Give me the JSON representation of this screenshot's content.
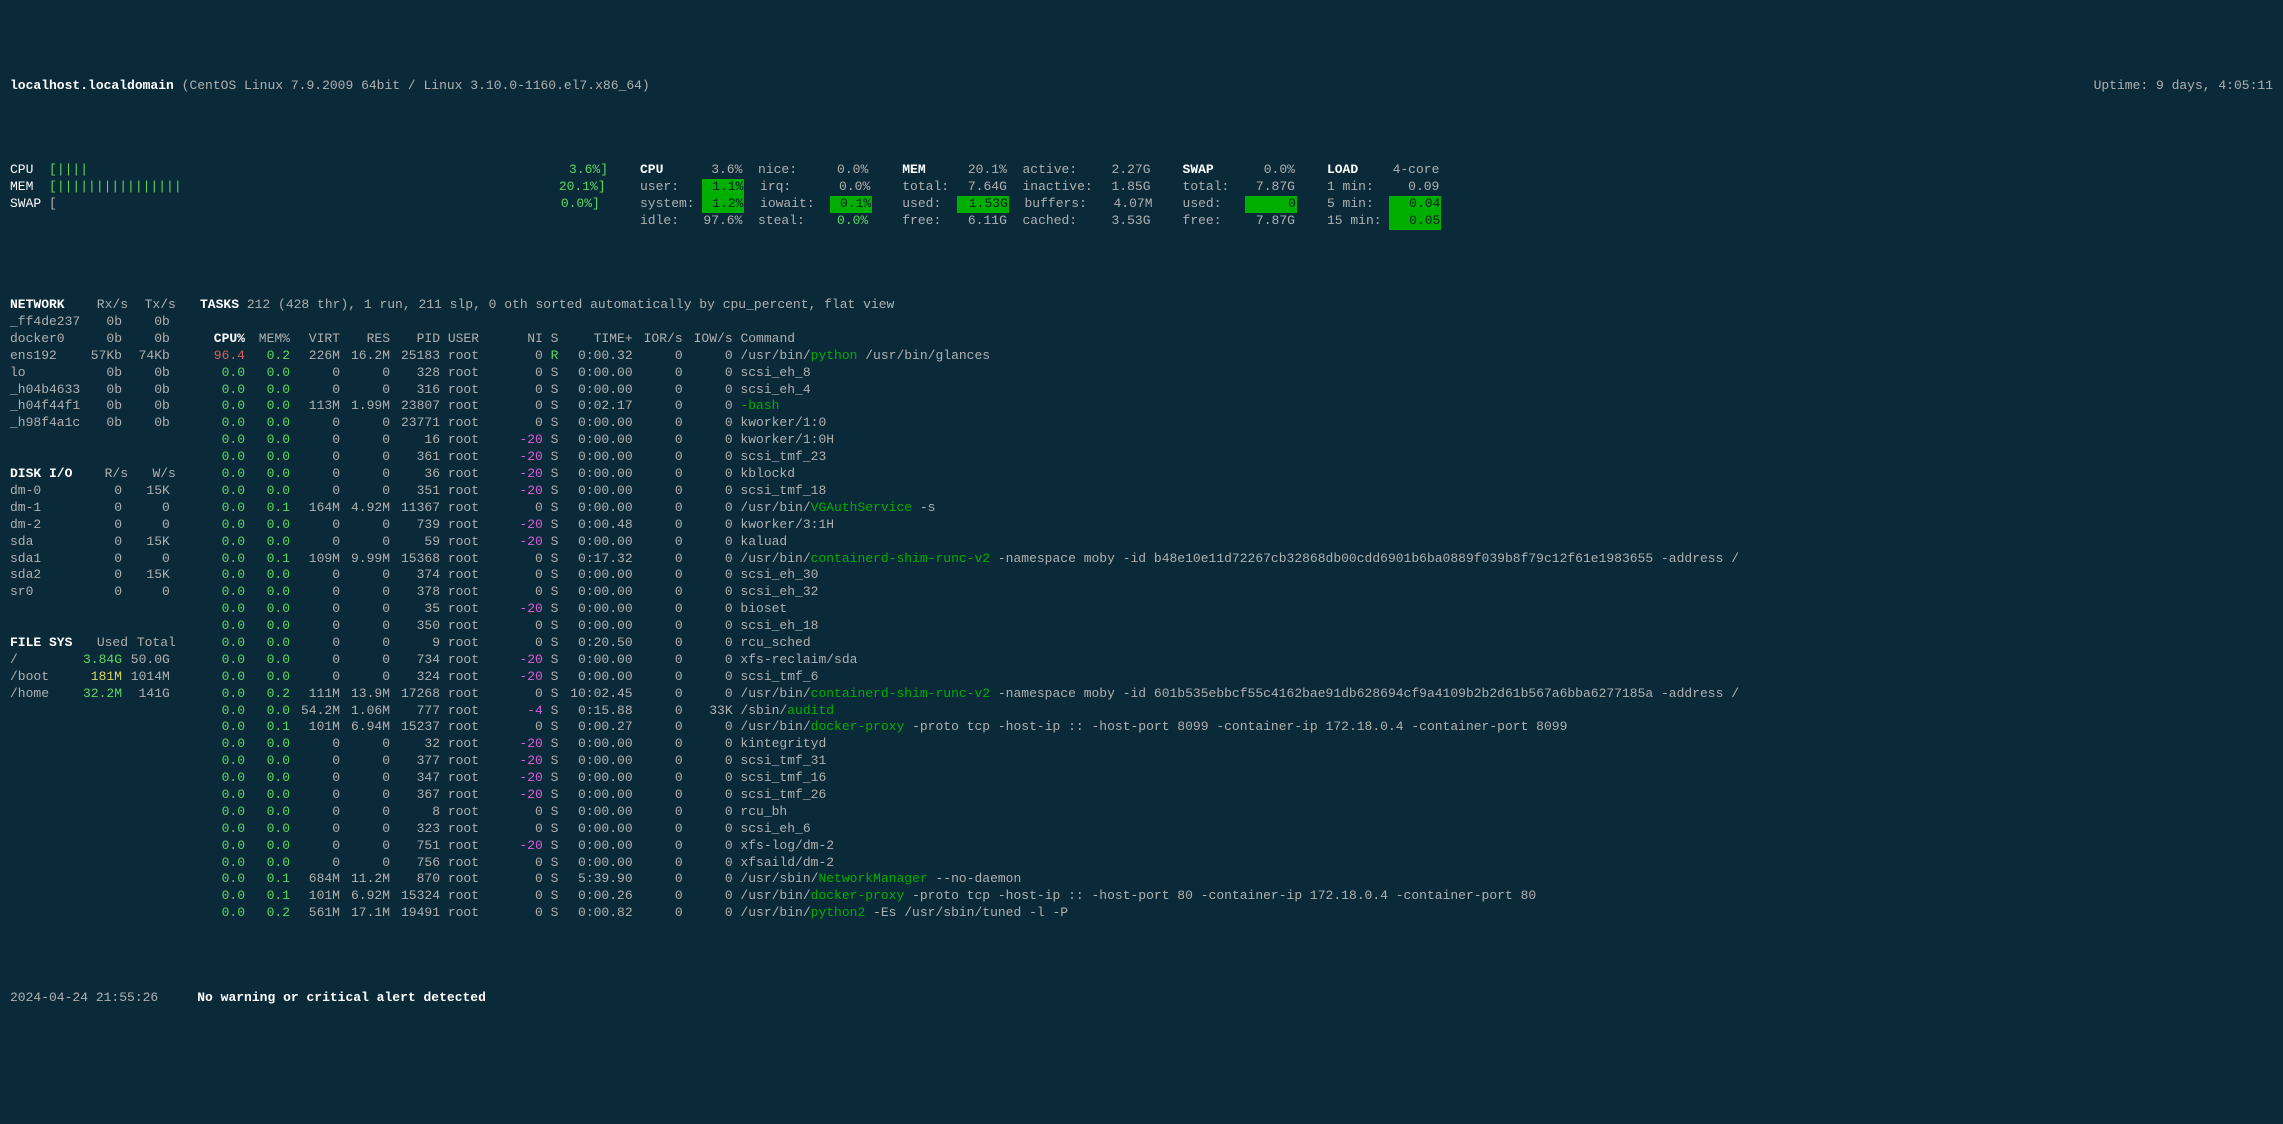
{
  "header": {
    "hostname": "localhost.localdomain",
    "os": "(CentOS Linux 7.9.2009 64bit / Linux 3.10.0-1160.el7.x86_64)",
    "uptime": "Uptime: 9 days, 4:05:11"
  },
  "bars": {
    "cpu_label": "CPU",
    "cpu_bar": "[||||",
    "cpu_pct": "3.6%]",
    "mem_label": "MEM",
    "mem_bar": "[||||||||||||||||",
    "mem_pct": "20.1%]",
    "swap_label": "SWAP",
    "swap_bar": "[",
    "swap_pct": "0.0%]"
  },
  "cpu_detail": {
    "cpu": "CPU",
    "cpu_v": "3.6%",
    "user": "user:",
    "user_v": "1.1%",
    "system": "system:",
    "system_v": "1.2%",
    "idle": "idle:",
    "idle_v": "97.6%",
    "nice": "nice:",
    "nice_v": "0.0%",
    "irq": "irq:",
    "irq_v": "0.0%",
    "iowait": "iowait:",
    "iowait_v": "0.1%",
    "steal": "steal:",
    "steal_v": "0.0%"
  },
  "mem_detail": {
    "mem": "MEM",
    "mem_v": "20.1%",
    "total": "total:",
    "total_v": "7.64G",
    "used": "used:",
    "used_v": "1.53G",
    "free": "free:",
    "free_v": "6.11G",
    "active": "active:",
    "active_v": "2.27G",
    "inactive": "inactive:",
    "inactive_v": "1.85G",
    "buffers": "buffers:",
    "buffers_v": "4.07M",
    "cached": "cached:",
    "cached_v": "3.53G"
  },
  "swap_detail": {
    "swap": "SWAP",
    "swap_v": "0.0%",
    "total": "total:",
    "total_v": "7.87G",
    "used": "used:",
    "used_v": "0",
    "free": "free:",
    "free_v": "7.87G"
  },
  "load_detail": {
    "load": "LOAD",
    "cores": "4-core",
    "l1": "1 min:",
    "l1v": "0.09",
    "l5": "5 min:",
    "l5v": "0.04",
    "l15": "15 min:",
    "l15v": "0.05"
  },
  "network": {
    "title": "NETWORK",
    "rx": "Rx/s",
    "tx": "Tx/s",
    "rows": [
      {
        "n": "_ff4de237",
        "rx": "0b",
        "tx": "0b"
      },
      {
        "n": "docker0",
        "rx": "0b",
        "tx": "0b"
      },
      {
        "n": "ens192",
        "rx": "57Kb",
        "tx": "74Kb"
      },
      {
        "n": "lo",
        "rx": "0b",
        "tx": "0b"
      },
      {
        "n": "_h04b4633",
        "rx": "0b",
        "tx": "0b"
      },
      {
        "n": "_h04f44f1",
        "rx": "0b",
        "tx": "0b"
      },
      {
        "n": "_h98f4a1c",
        "rx": "0b",
        "tx": "0b"
      }
    ]
  },
  "diskio": {
    "title": "DISK I/O",
    "r": "R/s",
    "w": "W/s",
    "rows": [
      {
        "n": "dm-0",
        "r": "0",
        "w": "15K"
      },
      {
        "n": "dm-1",
        "r": "0",
        "w": "0"
      },
      {
        "n": "dm-2",
        "r": "0",
        "w": "0"
      },
      {
        "n": "sda",
        "r": "0",
        "w": "15K"
      },
      {
        "n": "sda1",
        "r": "0",
        "w": "0"
      },
      {
        "n": "sda2",
        "r": "0",
        "w": "15K"
      },
      {
        "n": "sr0",
        "r": "0",
        "w": "0"
      }
    ]
  },
  "fs": {
    "title": "FILE SYS",
    "used": "Used",
    "total": "Total",
    "rows": [
      {
        "n": "/",
        "u": "3.84G",
        "t": "50.0G",
        "c": "green"
      },
      {
        "n": "/boot",
        "u": "181M",
        "t": "1014M",
        "c": "yellow"
      },
      {
        "n": "/home",
        "u": "32.2M",
        "t": "141G",
        "c": "green"
      }
    ]
  },
  "tasks_hdr": {
    "title": "TASKS",
    "summary": "212 (428 thr), 1 run, 211 slp, 0 oth sorted automatically by cpu_percent, flat view"
  },
  "proc_hdr": [
    "CPU%",
    "MEM%",
    "VIRT",
    "RES",
    "PID",
    "USER",
    "NI",
    "S",
    "TIME+",
    "IOR/s",
    "IOW/s",
    "Command"
  ],
  "procs": [
    {
      "cpu": "96.4",
      "cpuc": "red",
      "mem": "0.2",
      "virt": "226M",
      "res": "16.2M",
      "pid": "25183",
      "user": "root",
      "ni": "0",
      "s": "R",
      "sc": "green",
      "time": "0:00.32",
      "ior": "0",
      "iow": "0",
      "cmd": "/usr/bin/",
      "hl": "python",
      "rest": " /usr/bin/glances"
    },
    {
      "cpu": "0.0",
      "cpuc": "green",
      "mem": "0.0",
      "virt": "0",
      "res": "0",
      "pid": "328",
      "user": "root",
      "ni": "0",
      "s": "S",
      "time": "0:00.00",
      "ior": "0",
      "iow": "0",
      "cmd": "scsi_eh_8"
    },
    {
      "cpu": "0.0",
      "cpuc": "green",
      "mem": "0.0",
      "virt": "0",
      "res": "0",
      "pid": "316",
      "user": "root",
      "ni": "0",
      "s": "S",
      "time": "0:00.00",
      "ior": "0",
      "iow": "0",
      "cmd": "scsi_eh_4"
    },
    {
      "cpu": "0.0",
      "cpuc": "green",
      "mem": "0.0",
      "virt": "113M",
      "res": "1.99M",
      "pid": "23807",
      "user": "root",
      "ni": "0",
      "s": "S",
      "time": "0:02.17",
      "ior": "0",
      "iow": "0",
      "cmd": "",
      "hl": "-bash",
      "rest": ""
    },
    {
      "cpu": "0.0",
      "cpuc": "green",
      "mem": "0.0",
      "virt": "0",
      "res": "0",
      "pid": "23771",
      "user": "root",
      "ni": "0",
      "s": "S",
      "time": "0:00.00",
      "ior": "0",
      "iow": "0",
      "cmd": "kworker/1:0"
    },
    {
      "cpu": "0.0",
      "cpuc": "green",
      "mem": "0.0",
      "virt": "0",
      "res": "0",
      "pid": "16",
      "user": "root",
      "ni": "-20",
      "nic": "magenta",
      "s": "S",
      "time": "0:00.00",
      "ior": "0",
      "iow": "0",
      "cmd": "kworker/1:0H"
    },
    {
      "cpu": "0.0",
      "cpuc": "green",
      "mem": "0.0",
      "virt": "0",
      "res": "0",
      "pid": "361",
      "user": "root",
      "ni": "-20",
      "nic": "magenta",
      "s": "S",
      "time": "0:00.00",
      "ior": "0",
      "iow": "0",
      "cmd": "scsi_tmf_23"
    },
    {
      "cpu": "0.0",
      "cpuc": "green",
      "mem": "0.0",
      "virt": "0",
      "res": "0",
      "pid": "36",
      "user": "root",
      "ni": "-20",
      "nic": "magenta",
      "s": "S",
      "time": "0:00.00",
      "ior": "0",
      "iow": "0",
      "cmd": "kblockd"
    },
    {
      "cpu": "0.0",
      "cpuc": "green",
      "mem": "0.0",
      "virt": "0",
      "res": "0",
      "pid": "351",
      "user": "root",
      "ni": "-20",
      "nic": "magenta",
      "s": "S",
      "time": "0:00.00",
      "ior": "0",
      "iow": "0",
      "cmd": "scsi_tmf_18"
    },
    {
      "cpu": "0.0",
      "cpuc": "green",
      "mem": "0.1",
      "virt": "164M",
      "res": "4.92M",
      "pid": "11367",
      "user": "root",
      "ni": "0",
      "s": "S",
      "time": "0:00.00",
      "ior": "0",
      "iow": "0",
      "cmd": "/usr/bin/",
      "hl": "VGAuthService",
      "rest": " -s"
    },
    {
      "cpu": "0.0",
      "cpuc": "green",
      "mem": "0.0",
      "virt": "0",
      "res": "0",
      "pid": "739",
      "user": "root",
      "ni": "-20",
      "nic": "magenta",
      "s": "S",
      "time": "0:00.48",
      "ior": "0",
      "iow": "0",
      "cmd": "kworker/3:1H"
    },
    {
      "cpu": "0.0",
      "cpuc": "green",
      "mem": "0.0",
      "virt": "0",
      "res": "0",
      "pid": "59",
      "user": "root",
      "ni": "-20",
      "nic": "magenta",
      "s": "S",
      "time": "0:00.00",
      "ior": "0",
      "iow": "0",
      "cmd": "kaluad"
    },
    {
      "cpu": "0.0",
      "cpuc": "green",
      "mem": "0.1",
      "virt": "109M",
      "res": "9.99M",
      "pid": "15368",
      "user": "root",
      "ni": "0",
      "s": "S",
      "time": "0:17.32",
      "ior": "0",
      "iow": "0",
      "cmd": "/usr/bin/",
      "hl": "containerd-shim-runc-v2",
      "rest": " -namespace moby -id b48e10e11d72267cb32868db00cdd6901b6ba0889f039b8f79c12f61e1983655 -address /"
    },
    {
      "cpu": "0.0",
      "cpuc": "green",
      "mem": "0.0",
      "virt": "0",
      "res": "0",
      "pid": "374",
      "user": "root",
      "ni": "0",
      "s": "S",
      "time": "0:00.00",
      "ior": "0",
      "iow": "0",
      "cmd": "scsi_eh_30"
    },
    {
      "cpu": "0.0",
      "cpuc": "green",
      "mem": "0.0",
      "virt": "0",
      "res": "0",
      "pid": "378",
      "user": "root",
      "ni": "0",
      "s": "S",
      "time": "0:00.00",
      "ior": "0",
      "iow": "0",
      "cmd": "scsi_eh_32"
    },
    {
      "cpu": "0.0",
      "cpuc": "green",
      "mem": "0.0",
      "virt": "0",
      "res": "0",
      "pid": "35",
      "user": "root",
      "ni": "-20",
      "nic": "magenta",
      "s": "S",
      "time": "0:00.00",
      "ior": "0",
      "iow": "0",
      "cmd": "bioset"
    },
    {
      "cpu": "0.0",
      "cpuc": "green",
      "mem": "0.0",
      "virt": "0",
      "res": "0",
      "pid": "350",
      "user": "root",
      "ni": "0",
      "s": "S",
      "time": "0:00.00",
      "ior": "0",
      "iow": "0",
      "cmd": "scsi_eh_18"
    },
    {
      "cpu": "0.0",
      "cpuc": "green",
      "mem": "0.0",
      "virt": "0",
      "res": "0",
      "pid": "9",
      "user": "root",
      "ni": "0",
      "s": "S",
      "time": "0:20.50",
      "ior": "0",
      "iow": "0",
      "cmd": "rcu_sched"
    },
    {
      "cpu": "0.0",
      "cpuc": "green",
      "mem": "0.0",
      "virt": "0",
      "res": "0",
      "pid": "734",
      "user": "root",
      "ni": "-20",
      "nic": "magenta",
      "s": "S",
      "time": "0:00.00",
      "ior": "0",
      "iow": "0",
      "cmd": "xfs-reclaim/sda"
    },
    {
      "cpu": "0.0",
      "cpuc": "green",
      "mem": "0.0",
      "virt": "0",
      "res": "0",
      "pid": "324",
      "user": "root",
      "ni": "-20",
      "nic": "magenta",
      "s": "S",
      "time": "0:00.00",
      "ior": "0",
      "iow": "0",
      "cmd": "scsi_tmf_6"
    },
    {
      "cpu": "0.0",
      "cpuc": "green",
      "mem": "0.2",
      "virt": "111M",
      "res": "13.9M",
      "pid": "17268",
      "user": "root",
      "ni": "0",
      "s": "S",
      "time": "10:02.45",
      "ior": "0",
      "iow": "0",
      "cmd": "/usr/bin/",
      "hl": "containerd-shim-runc-v2",
      "rest": " -namespace moby -id 601b535ebbcf55c4162bae91db628694cf9a4109b2b2d61b567a6bba6277185a -address /"
    },
    {
      "cpu": "0.0",
      "cpuc": "green",
      "mem": "0.0",
      "virt": "54.2M",
      "res": "1.06M",
      "pid": "777",
      "user": "root",
      "ni": "-4",
      "nic": "magenta",
      "s": "S",
      "time": "0:15.88",
      "ior": "0",
      "iow": "33K",
      "cmd": "/sbin/",
      "hl": "auditd",
      "rest": ""
    },
    {
      "cpu": "0.0",
      "cpuc": "green",
      "mem": "0.1",
      "virt": "101M",
      "res": "6.94M",
      "pid": "15237",
      "user": "root",
      "ni": "0",
      "s": "S",
      "time": "0:00.27",
      "ior": "0",
      "iow": "0",
      "cmd": "/usr/bin/",
      "hl": "docker-proxy",
      "rest": " -proto tcp -host-ip :: -host-port 8099 -container-ip 172.18.0.4 -container-port 8099"
    },
    {
      "cpu": "0.0",
      "cpuc": "green",
      "mem": "0.0",
      "virt": "0",
      "res": "0",
      "pid": "32",
      "user": "root",
      "ni": "-20",
      "nic": "magenta",
      "s": "S",
      "time": "0:00.00",
      "ior": "0",
      "iow": "0",
      "cmd": "kintegrityd"
    },
    {
      "cpu": "0.0",
      "cpuc": "green",
      "mem": "0.0",
      "virt": "0",
      "res": "0",
      "pid": "377",
      "user": "root",
      "ni": "-20",
      "nic": "magenta",
      "s": "S",
      "time": "0:00.00",
      "ior": "0",
      "iow": "0",
      "cmd": "scsi_tmf_31"
    },
    {
      "cpu": "0.0",
      "cpuc": "green",
      "mem": "0.0",
      "virt": "0",
      "res": "0",
      "pid": "347",
      "user": "root",
      "ni": "-20",
      "nic": "magenta",
      "s": "S",
      "time": "0:00.00",
      "ior": "0",
      "iow": "0",
      "cmd": "scsi_tmf_16"
    },
    {
      "cpu": "0.0",
      "cpuc": "green",
      "mem": "0.0",
      "virt": "0",
      "res": "0",
      "pid": "367",
      "user": "root",
      "ni": "-20",
      "nic": "magenta",
      "s": "S",
      "time": "0:00.00",
      "ior": "0",
      "iow": "0",
      "cmd": "scsi_tmf_26"
    },
    {
      "cpu": "0.0",
      "cpuc": "green",
      "mem": "0.0",
      "virt": "0",
      "res": "0",
      "pid": "8",
      "user": "root",
      "ni": "0",
      "s": "S",
      "time": "0:00.00",
      "ior": "0",
      "iow": "0",
      "cmd": "rcu_bh"
    },
    {
      "cpu": "0.0",
      "cpuc": "green",
      "mem": "0.0",
      "virt": "0",
      "res": "0",
      "pid": "323",
      "user": "root",
      "ni": "0",
      "s": "S",
      "time": "0:00.00",
      "ior": "0",
      "iow": "0",
      "cmd": "scsi_eh_6"
    },
    {
      "cpu": "0.0",
      "cpuc": "green",
      "mem": "0.0",
      "virt": "0",
      "res": "0",
      "pid": "751",
      "user": "root",
      "ni": "-20",
      "nic": "magenta",
      "s": "S",
      "time": "0:00.00",
      "ior": "0",
      "iow": "0",
      "cmd": "xfs-log/dm-2"
    },
    {
      "cpu": "0.0",
      "cpuc": "green",
      "mem": "0.0",
      "virt": "0",
      "res": "0",
      "pid": "756",
      "user": "root",
      "ni": "0",
      "s": "S",
      "time": "0:00.00",
      "ior": "0",
      "iow": "0",
      "cmd": "xfsaild/dm-2"
    },
    {
      "cpu": "0.0",
      "cpuc": "green",
      "mem": "0.1",
      "virt": "684M",
      "res": "11.2M",
      "pid": "870",
      "user": "root",
      "ni": "0",
      "s": "S",
      "time": "5:39.90",
      "ior": "0",
      "iow": "0",
      "cmd": "/usr/sbin/",
      "hl": "NetworkManager",
      "rest": " --no-daemon"
    },
    {
      "cpu": "0.0",
      "cpuc": "green",
      "mem": "0.1",
      "virt": "101M",
      "res": "6.92M",
      "pid": "15324",
      "user": "root",
      "ni": "0",
      "s": "S",
      "time": "0:00.26",
      "ior": "0",
      "iow": "0",
      "cmd": "/usr/bin/",
      "hl": "docker-proxy",
      "rest": " -proto tcp -host-ip :: -host-port 80 -container-ip 172.18.0.4 -container-port 80"
    },
    {
      "cpu": "0.0",
      "cpuc": "green",
      "mem": "0.2",
      "virt": "561M",
      "res": "17.1M",
      "pid": "19491",
      "user": "root",
      "ni": "0",
      "s": "S",
      "time": "0:00.82",
      "ior": "0",
      "iow": "0",
      "cmd": "/usr/bin/",
      "hl": "python2",
      "rest": " -Es /usr/sbin/tuned -l -P"
    }
  ],
  "footer": {
    "time": "2024-04-24 21:55:26",
    "alert": "No warning or critical alert detected"
  }
}
